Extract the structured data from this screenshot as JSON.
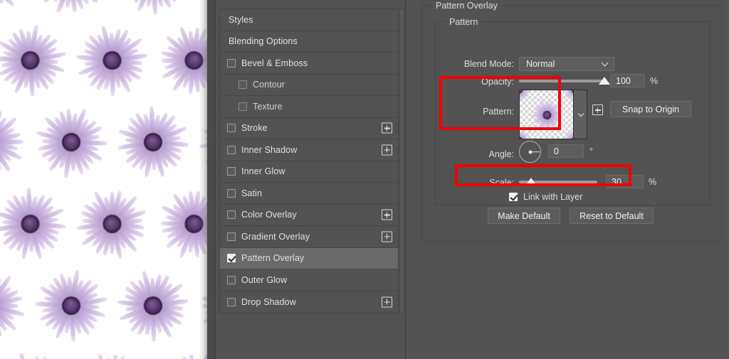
{
  "canvas": {
    "name": "pattern-preview-canvas",
    "description": "Repeating purple daisy flower pattern on white background",
    "flower_petal_color": "#c9b4de",
    "flower_center_color": "#5b3a72",
    "background_color": "#ffffff"
  },
  "effects_list": {
    "items": [
      {
        "label": "Styles",
        "type": "plain",
        "checkbox": false,
        "checked": false,
        "plus": false,
        "selected": false
      },
      {
        "label": "Blending Options",
        "type": "plain",
        "checkbox": false,
        "checked": false,
        "plus": false,
        "selected": false
      },
      {
        "label": "Bevel & Emboss",
        "type": "normal",
        "checkbox": true,
        "checked": false,
        "plus": false,
        "selected": false
      },
      {
        "label": "Contour",
        "type": "sub",
        "checkbox": true,
        "checked": false,
        "plus": false,
        "selected": false
      },
      {
        "label": "Texture",
        "type": "sub",
        "checkbox": true,
        "checked": false,
        "plus": false,
        "selected": false
      },
      {
        "label": "Stroke",
        "type": "normal",
        "checkbox": true,
        "checked": false,
        "plus": true,
        "selected": false
      },
      {
        "label": "Inner Shadow",
        "type": "normal",
        "checkbox": true,
        "checked": false,
        "plus": true,
        "selected": false
      },
      {
        "label": "Inner Glow",
        "type": "normal",
        "checkbox": true,
        "checked": false,
        "plus": false,
        "selected": false
      },
      {
        "label": "Satin",
        "type": "normal",
        "checkbox": true,
        "checked": false,
        "plus": false,
        "selected": false
      },
      {
        "label": "Color Overlay",
        "type": "normal",
        "checkbox": true,
        "checked": false,
        "plus": true,
        "selected": false
      },
      {
        "label": "Gradient Overlay",
        "type": "normal",
        "checkbox": true,
        "checked": false,
        "plus": true,
        "selected": false
      },
      {
        "label": "Pattern Overlay",
        "type": "normal",
        "checkbox": true,
        "checked": true,
        "plus": false,
        "selected": true
      },
      {
        "label": "Outer Glow",
        "type": "normal",
        "checkbox": true,
        "checked": false,
        "plus": false,
        "selected": false
      },
      {
        "label": "Drop Shadow",
        "type": "normal",
        "checkbox": true,
        "checked": false,
        "plus": true,
        "selected": false
      }
    ]
  },
  "settings": {
    "group_title": "Pattern Overlay",
    "subgroup_title": "Pattern",
    "blend_mode": {
      "label": "Blend Mode:",
      "value": "Normal"
    },
    "opacity": {
      "label": "Opacity:",
      "value": "100",
      "unit": "%",
      "percent": 100
    },
    "pattern": {
      "label": "Pattern:",
      "snap_button": "Snap to Origin"
    },
    "angle": {
      "label": "Angle:",
      "value": "0",
      "unit": "°",
      "degrees": 0
    },
    "scale": {
      "label": "Scale:",
      "value": "30",
      "unit": "%",
      "percent": 30
    },
    "link_with_layer": {
      "label": "Link with Layer",
      "checked": true
    },
    "make_default": "Make Default",
    "reset_to_default": "Reset to Default"
  },
  "annotations": {
    "highlight_color": "#f40000",
    "boxes": [
      {
        "name": "pattern-row-highlight",
        "target": "Pattern swatch row"
      },
      {
        "name": "scale-row-highlight",
        "target": "Scale slider row"
      }
    ]
  }
}
